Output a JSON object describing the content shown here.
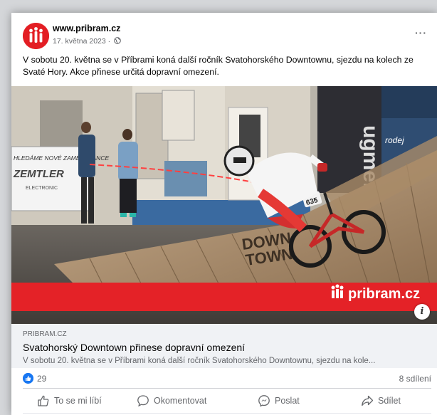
{
  "post": {
    "page_name": "www.pribram.cz",
    "date": "17. května 2023 ·",
    "more_label": "···",
    "text": "V sobotu 20. května se v Příbrami koná další ročník Svatohorského Downtownu, sjezdu na kolech ze Svaté Hory. Akce přinese určitá dopravní omezení."
  },
  "photo": {
    "banner_text": "HLEDÁME NOVÉ ZAMĚSTNANCE",
    "banner_brand": "ZEMTLER",
    "banner_sub": "ELECTRONIC",
    "ramp_text_1": "DOWN",
    "ramp_text_2": "TOWN",
    "bike_number": "635",
    "watermark": "pribram.cz",
    "info_label": "i"
  },
  "link_preview": {
    "domain": "PRIBRAM.CZ",
    "title": "Svatohorský Downtown přinese dopravní omezení",
    "description": "V sobotu 20. května se v Příbrami koná další ročník Svatohorského Downtownu, sjezdu na kole..."
  },
  "stats": {
    "likes": "29",
    "shares": "8 sdílení"
  },
  "actions": {
    "like": "To se mi líbí",
    "comment": "Okomentovat",
    "send": "Poslat",
    "share": "Sdílet"
  },
  "colors": {
    "brand_red": "#e31e24",
    "facebook_blue": "#1877f2",
    "secondary_text": "#65676b"
  },
  "icons": {
    "avatar": "pribram-logo-icon",
    "audience": "globe-icon",
    "like_badge": "thumbs-up-icon",
    "like": "thumbs-up-outline-icon",
    "comment": "speech-bubble-icon",
    "send": "messenger-icon",
    "share": "share-arrow-icon",
    "info": "info-icon"
  }
}
